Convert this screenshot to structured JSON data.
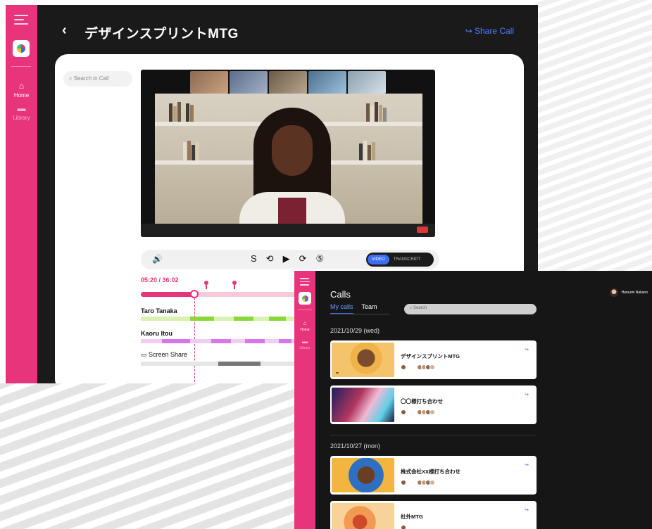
{
  "desktop": {
    "nav": {
      "home": "Home",
      "library": "Library"
    },
    "topbar": {
      "back": "‹",
      "title": "デザインスプリントMTG",
      "share_label": "Share Call",
      "share_icon": "↪"
    },
    "search_placeholder": "Search in Call",
    "player": {
      "volume_icon": "🔊",
      "controls": [
        "S",
        "⟲",
        "▶",
        "⟳",
        "⑤"
      ],
      "seg_video": "VIDEO",
      "seg_transcript": "TRANSCRIPT"
    },
    "timeline": {
      "current_time": "05:20 / 36:02",
      "speakers": [
        "Taro Tanaka",
        "Kaoru Itou"
      ],
      "screen_share_label": "Screen Share",
      "progress": 0.33
    }
  },
  "mobile": {
    "nav": {
      "home": "Home",
      "library": "Library"
    },
    "heading": "Calls",
    "tabs": [
      "My calls",
      "Team"
    ],
    "search_placeholder": "Search",
    "user": {
      "name": "Haruumi Nakano"
    },
    "groups": [
      {
        "date": "2021/10/29 (wed)"
      },
      {
        "date": "2021/10/27 (mon)"
      }
    ],
    "calls": [
      {
        "title": "デザインスプリントMTG"
      },
      {
        "title": "〇〇様打ち合わせ"
      },
      {
        "title": "株式会社XX様打ち合わせ"
      },
      {
        "title": "社外MTG"
      }
    ]
  },
  "colors": {
    "accent": "#e8347a",
    "link": "#3b6cf6",
    "dark": "#1a1a1a"
  }
}
